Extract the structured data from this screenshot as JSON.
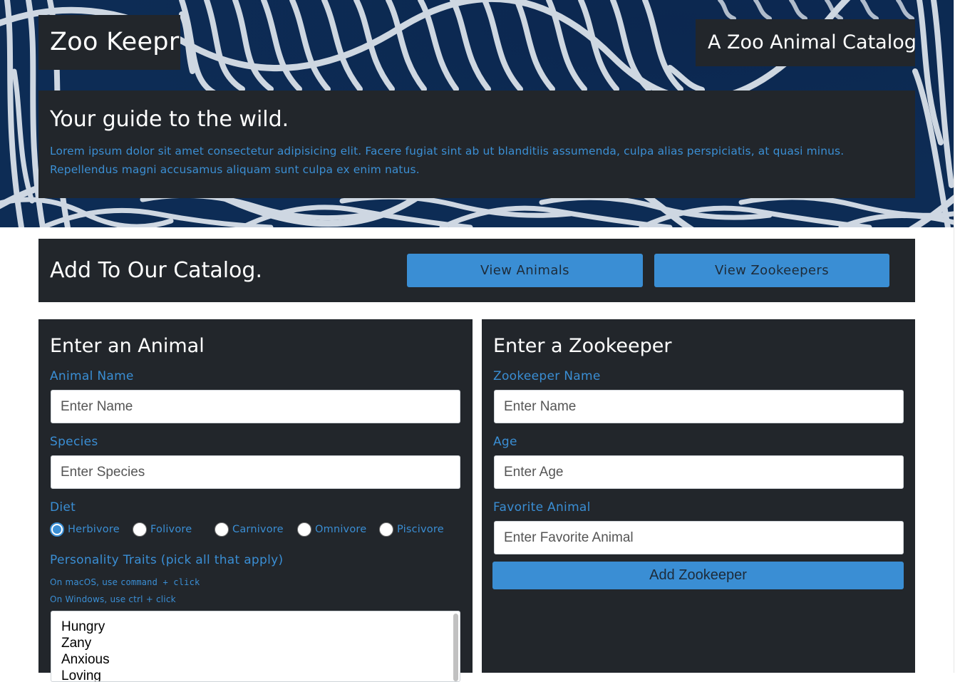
{
  "header": {
    "brand": "Zoo Keepr",
    "tagline": "A Zoo Animal Catalog",
    "intro_title": "Your guide to the wild.",
    "intro_text": "Lorem ipsum dolor sit amet consectetur adipisicing elit. Facere fugiat sint ab ut blanditiis assumenda, culpa alias perspiciatis, at quasi minus. Repellendus magni accusamus aliquam sunt culpa ex enim natus."
  },
  "catalog_bar": {
    "title": "Add To Our Catalog.",
    "view_animals": "View Animals",
    "view_zookeepers": "View Zookeepers"
  },
  "animal_form": {
    "title": "Enter an Animal",
    "name_label": "Animal Name",
    "name_placeholder": "Enter Name",
    "species_label": "Species",
    "species_placeholder": "Enter Species",
    "diet_label": "Diet",
    "diet_options": [
      "Herbivore",
      "Folivore",
      "Carnivore",
      "Omnivore",
      "Piscivore"
    ],
    "diet_selected": "Herbivore",
    "traits_label": "Personality Traits (pick all that apply)",
    "hint_mac_prefix": "On macOS, use",
    "hint_mac_keys": "command + click",
    "hint_windows": "On Windows, use ctrl + click",
    "traits": [
      "Hungry",
      "Zany",
      "Anxious",
      "Loving"
    ]
  },
  "keeper_form": {
    "title": "Enter a Zookeeper",
    "name_label": "Zookeeper Name",
    "name_placeholder": "Enter Name",
    "age_label": "Age",
    "age_placeholder": "Enter Age",
    "favorite_label": "Favorite Animal",
    "favorite_placeholder": "Enter Favorite Animal",
    "submit": "Add Zookeeper"
  },
  "colors": {
    "panel": "#22262b",
    "accent": "#3a8ed4",
    "hero_blue": "#0d2c55",
    "stripe": "#dfe6ee"
  }
}
